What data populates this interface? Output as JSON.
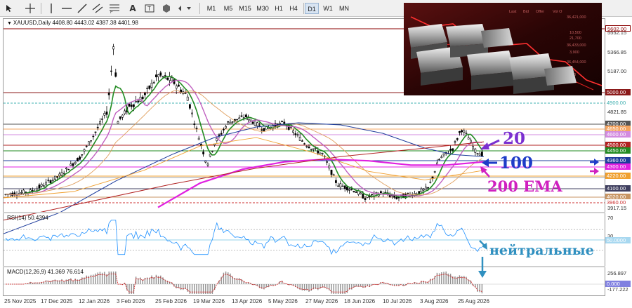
{
  "toolbar": {
    "icons": [
      "cursor-icon",
      "crosshair-icon",
      "vertical-line-icon",
      "horizontal-line-icon",
      "trendline-icon",
      "equidistant-channel-icon",
      "fibonacci-icon",
      "text-icon",
      "text-label-icon",
      "shapes-icon"
    ],
    "timeframes": [
      "M1",
      "M5",
      "M15",
      "M30",
      "H1",
      "H4",
      "D1",
      "W1",
      "MN"
    ],
    "active_timeframe": "D1"
  },
  "symbol_header": "XAUUSD,Daily  4408.80 4443.02 4387.38 4401.98",
  "price_scale": {
    "ticks": [
      "5552.15",
      "5366.85",
      "5187.00",
      "4821.85",
      "3917.15"
    ],
    "levels": [
      {
        "text": "5602.00",
        "bg": "#ffffff",
        "fg": "#8b0000",
        "line": "#8b0000",
        "border": true
      },
      {
        "text": "5000.00",
        "bg": "#8b1a1a",
        "fg": "#ffffff",
        "line": "#8b1a1a"
      },
      {
        "text": "4900.00",
        "bg": "#ffffff",
        "fg": "#40b0b0",
        "line": "#40b0b0",
        "dashed": true
      },
      {
        "text": "4700.00",
        "bg": "#555555",
        "fg": "#ffffff",
        "line": "#555555"
      },
      {
        "text": "4650.00",
        "bg": "#f4a460",
        "fg": "#ffffff",
        "line": "#f4a460"
      },
      {
        "text": "4600.00",
        "bg": "#d38be0",
        "fg": "#ffffff",
        "line": "#d38be0"
      },
      {
        "text": "4500.00",
        "bg": "#b22222",
        "fg": "#ffffff",
        "line": "#b22222"
      },
      {
        "text": "4450.00",
        "bg": "#228b22",
        "fg": "#ffffff",
        "line": "#228b22"
      },
      {
        "text": "4360.00",
        "bg": "#1e3c9c",
        "fg": "#ffffff",
        "line": "#1e3c9c"
      },
      {
        "text": "4300.00",
        "bg": "#e020e0",
        "fg": "#ffffff",
        "line": "#e020e0"
      },
      {
        "text": "4220.00",
        "bg": "#f0a030",
        "fg": "#ffffff",
        "line": "#f0a030"
      },
      {
        "text": "4100.00",
        "bg": "#404060",
        "fg": "#ffffff",
        "line": "#404060"
      },
      {
        "text": "4020.00",
        "bg": "#c89664",
        "fg": "#ffffff",
        "line": "#c89664"
      },
      {
        "text": "3960.00",
        "bg": "#ffffff",
        "fg": "#cc3030",
        "line": "#cc3030",
        "dashed": true
      }
    ]
  },
  "rsi": {
    "title": "RSI(14) 50.4394",
    "ticks": [
      "70",
      "30"
    ],
    "value_label": "50.0000"
  },
  "macd": {
    "title": "MACD(12,26,9) 41.369 76.614",
    "ticks": [
      "256.897",
      "-177.222"
    ],
    "value_label": "0.000"
  },
  "time_axis": [
    "25 Nov 2025",
    "17 Dec 2025",
    "12 Jan 2026",
    "3 Feb 2026",
    "25 Feb 2026",
    "19 Mar 2026",
    "13 Apr 2026",
    "5 May 2026",
    "27 May 2026",
    "18 Jun 2026",
    "10 Jul 2026",
    "3 Aug 2026",
    "25 Aug 2026"
  ],
  "annotations": {
    "ma20": "20",
    "ma100": "100",
    "ema200": "200 EMA",
    "neutral": "нейтральные"
  },
  "photo": {
    "table_header": [
      "Last",
      "Bid",
      "Offer",
      "Vol O"
    ],
    "table_values": [
      "36,421,000",
      "10,500",
      "21,700",
      "36,433,000",
      "3,900",
      "36,454,000",
      "210"
    ]
  },
  "colors": {
    "ma20": "#228b22",
    "ma50": "#c060c0",
    "ma100": "#1e3c9c",
    "ema200": "#e020e0",
    "annotation_purple": "#7a2fd0",
    "annotation_blue": "#1e3cc8",
    "annotation_magenta": "#d020c0",
    "annotation_teal": "#3090c0"
  }
}
